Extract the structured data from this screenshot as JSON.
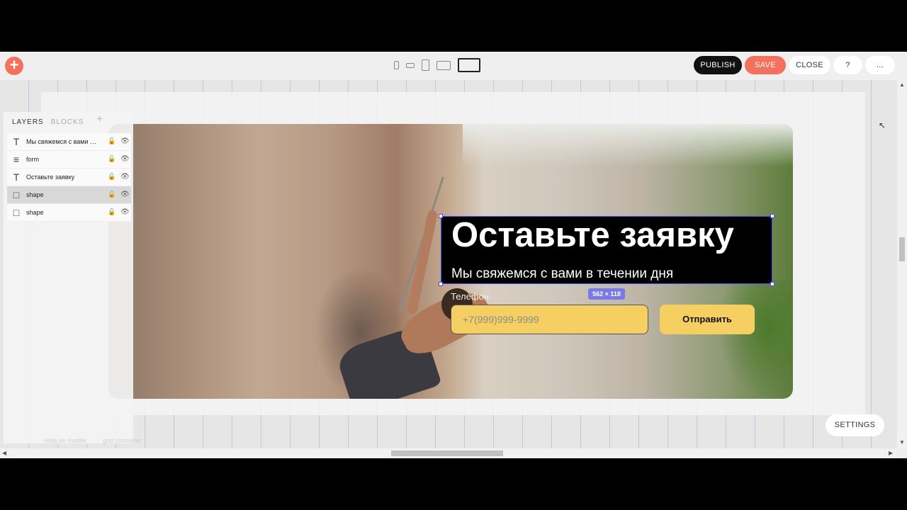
{
  "toolbar": {
    "add_icon": "plus-icon",
    "buttons": {
      "publish": "PUBLISH",
      "save": "SAVE",
      "close": "CLOSE",
      "help": "?",
      "more": "..."
    },
    "devices": [
      "mobile-portrait-icon",
      "mobile-landscape-icon",
      "tablet-portrait-icon",
      "tablet-landscape-icon",
      "desktop-icon"
    ],
    "active_device": "desktop-icon",
    "colors": {
      "publish": "#111111",
      "save": "#f4715d",
      "add": "#f4715d"
    }
  },
  "layers_panel": {
    "tabs": [
      "LAYERS",
      "BLOCKS"
    ],
    "active_tab": "LAYERS",
    "add_symbol": "+",
    "items": [
      {
        "icon": "T",
        "name": "Мы свяжемся с вами в...",
        "selected": false
      },
      {
        "icon": "≡",
        "name": "form",
        "selected": false
      },
      {
        "icon": "T",
        "name": "Оставьте заявку",
        "selected": false
      },
      {
        "icon": "□",
        "name": "shape",
        "selected": true
      },
      {
        "icon": "□",
        "name": "shape",
        "selected": false
      }
    ],
    "lock_symbol": "🔓",
    "eye_symbol": "👁",
    "footer_left": "Hide on mobile",
    "footer_right": "grid container"
  },
  "canvas": {
    "title": "Оставьте заявку",
    "subtitle": "Мы свяжемся с вами в течении дня",
    "size_badge": "562 × 118",
    "form": {
      "label": "Телефон",
      "placeholder": "+7(999)999-9999",
      "submit": "Отправить",
      "accent": "#f6cf63"
    }
  },
  "settings_button": "SETTINGS"
}
